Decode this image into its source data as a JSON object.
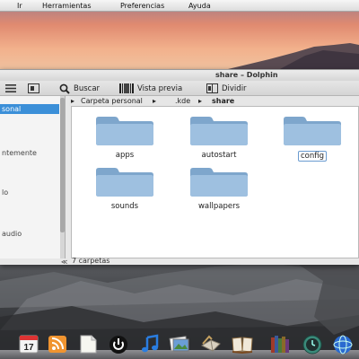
{
  "menubar": {
    "items": [
      "Ir",
      "Herramientas",
      "Preferencias",
      "Ayuda"
    ]
  },
  "window": {
    "title": "share – Dolphin"
  },
  "toolbar": {
    "buscar": "Buscar",
    "vista_previa": "Vista previa",
    "dividir": "Dividir"
  },
  "breadcrumb": {
    "items": [
      "Carpeta personal",
      ".kde",
      "share"
    ]
  },
  "sidebar": {
    "items": [
      {
        "label": "sonal",
        "selected": true
      },
      {
        "label": "ntemente",
        "selected": false
      },
      {
        "label": "lo",
        "selected": false
      },
      {
        "label": "audio",
        "selected": false
      }
    ]
  },
  "files": [
    {
      "name": "apps",
      "icon": "folder-icon"
    },
    {
      "name": "autostart",
      "icon": "folder-icon"
    },
    {
      "name": "config",
      "icon": "folder-icon",
      "focused": true
    },
    {
      "name": "sounds",
      "icon": "folder-icon"
    },
    {
      "name": "wallpapers",
      "icon": "folder-icon"
    }
  ],
  "status": {
    "text": "7 carpetas",
    "left_mark": "≪"
  },
  "dock": {
    "icons": [
      "calendar-icon",
      "rss-icon",
      "document-icon",
      "power-icon",
      "music-icon",
      "photos-icon",
      "mail-icon",
      "book-icon",
      "library-icon",
      "time-machine-icon",
      "globe-icon"
    ],
    "calendar_day": "17"
  },
  "colors": {
    "selection": "#3b8fd8",
    "folder": "#8fb4d8"
  }
}
